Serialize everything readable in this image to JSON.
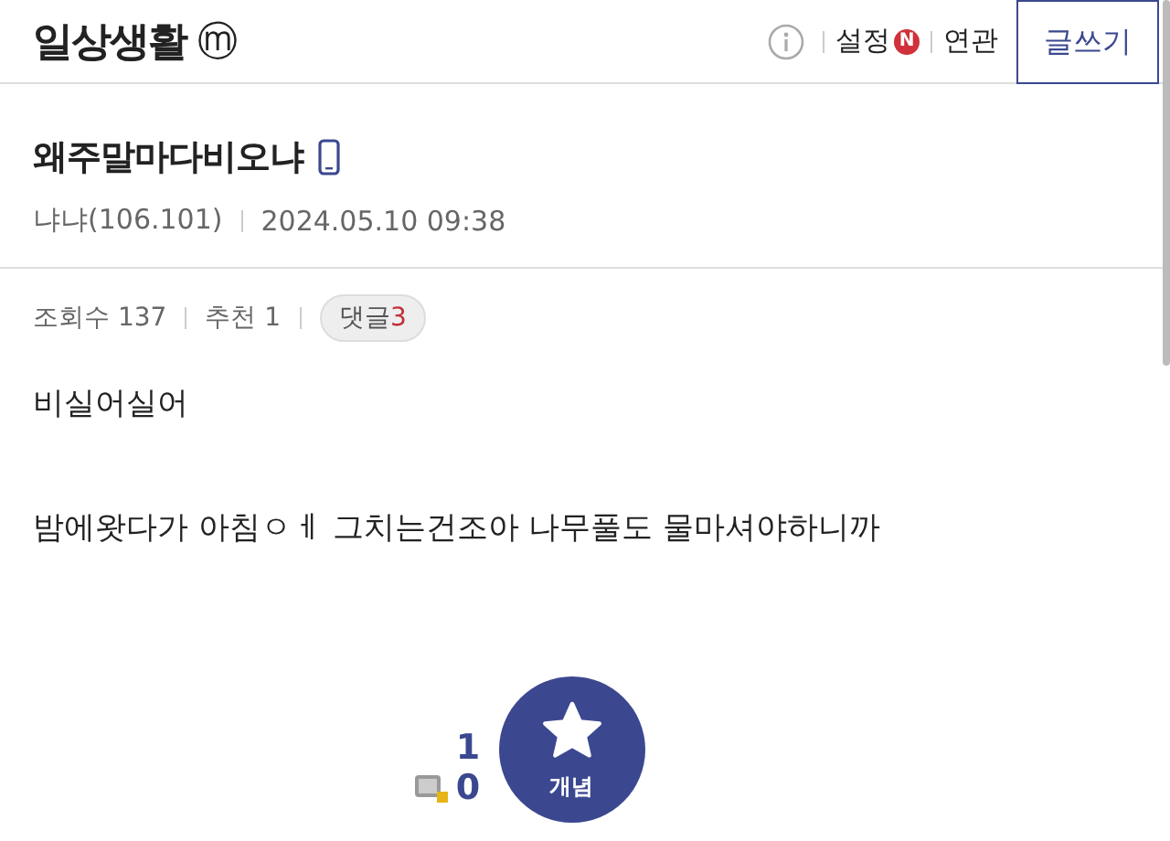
{
  "header": {
    "title": "일상생활",
    "title_badge": "ⓜ",
    "links": [
      {
        "label": "설정",
        "badge": "N"
      },
      {
        "label": "연관"
      }
    ],
    "write_button": "글쓰기"
  },
  "post": {
    "title": "왜주말마다비오냐",
    "from_mobile": true,
    "author": "냐냐(106.101)",
    "date": "2024.05.10 09:38",
    "stats": [
      {
        "label": "조회수 137"
      },
      {
        "label": "추천 1"
      }
    ],
    "comments": {
      "label": "댓글",
      "count": "3"
    },
    "paragraphs": [
      "비실어실어",
      "밤에왓다가 아침ㅇㅔ 그치는건조아 나무풀도 물마셔야하니까"
    ],
    "recommend": {
      "up_count": "1",
      "fixed_count": "0",
      "button": "개념"
    }
  }
}
